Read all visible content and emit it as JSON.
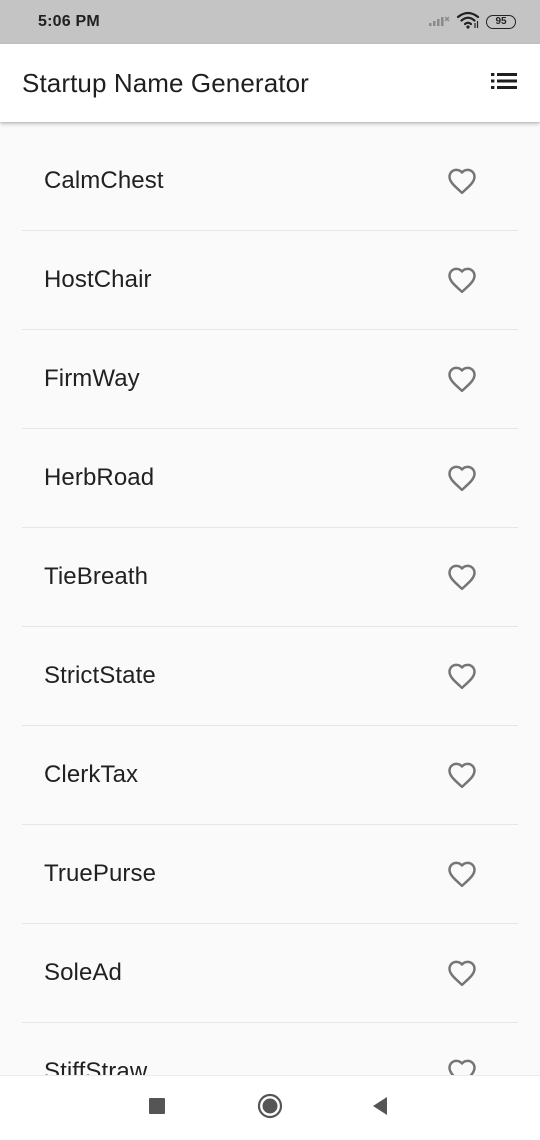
{
  "status_bar": {
    "time": "5:06 PM",
    "battery_level": "95",
    "icons": [
      "signal-icon",
      "wifi-icon",
      "battery-icon"
    ]
  },
  "app_bar": {
    "title": "Startup Name Generator",
    "action_icon": "list-icon"
  },
  "suggestions": [
    {
      "name": "CalmChest",
      "saved": false
    },
    {
      "name": "HostChair",
      "saved": false
    },
    {
      "name": "FirmWay",
      "saved": false
    },
    {
      "name": "HerbRoad",
      "saved": false
    },
    {
      "name": "TieBreath",
      "saved": false
    },
    {
      "name": "StrictState",
      "saved": false
    },
    {
      "name": "ClerkTax",
      "saved": false
    },
    {
      "name": "TruePurse",
      "saved": false
    },
    {
      "name": "SoleAd",
      "saved": false
    },
    {
      "name": "StiffStraw",
      "saved": false
    }
  ],
  "nav_bar": {
    "buttons": [
      "recents-icon",
      "home-icon",
      "back-icon"
    ]
  },
  "colors": {
    "status_bar_bg": "#c4c4c4",
    "app_bar_bg": "#ffffff",
    "list_bg": "#fafafa",
    "heart_outline": "#757575",
    "divider": "#e6e6e6"
  }
}
